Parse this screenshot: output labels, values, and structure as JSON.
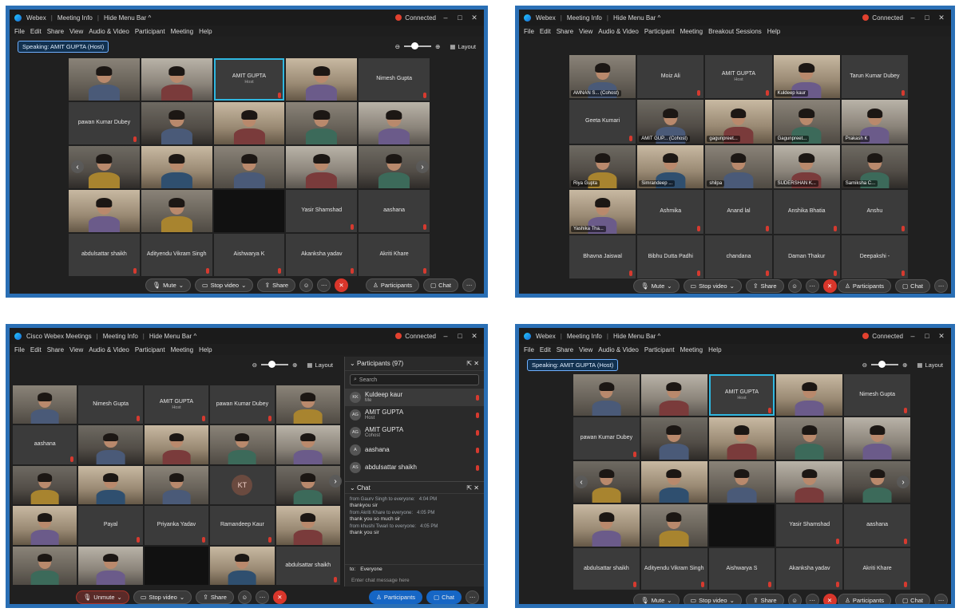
{
  "screens": {
    "tl": {
      "title": {
        "app": "Webex",
        "meeting_info": "Meeting Info",
        "hide_menu": "Hide Menu Bar ^",
        "connected": "Connected"
      },
      "menu": [
        "File",
        "Edit",
        "Share",
        "View",
        "Audio & Video",
        "Participant",
        "Meeting",
        "Help"
      ],
      "speaking": "Speaking: AMIT GUPTA (Host)",
      "layout_label": "Layout",
      "tiles": [
        {
          "type": "video",
          "label": ""
        },
        {
          "type": "video",
          "label": ""
        },
        {
          "type": "name",
          "name": "AMIT GUPTA",
          "sub": "Host",
          "active": true
        },
        {
          "type": "video",
          "label": ""
        },
        {
          "type": "name",
          "name": "Nimesh Gupta"
        },
        {
          "type": "name",
          "name": "pawan Kumar Dubey"
        },
        {
          "type": "video",
          "label": ""
        },
        {
          "type": "video",
          "label": ""
        },
        {
          "type": "video",
          "label": ""
        },
        {
          "type": "video",
          "label": ""
        },
        {
          "type": "video",
          "label": ""
        },
        {
          "type": "video",
          "label": ""
        },
        {
          "type": "video",
          "label": ""
        },
        {
          "type": "video",
          "label": ""
        },
        {
          "type": "video",
          "label": ""
        },
        {
          "type": "video",
          "label": ""
        },
        {
          "type": "video",
          "label": ""
        },
        {
          "type": "black"
        },
        {
          "type": "name",
          "name": "Yasir Shamshad"
        },
        {
          "type": "name",
          "name": "aashana"
        },
        {
          "type": "name",
          "name": "abdulsattar shaikh"
        },
        {
          "type": "name",
          "name": "Adityendu Vikram Singh"
        },
        {
          "type": "name",
          "name": "Aishwarya K"
        },
        {
          "type": "name",
          "name": "Akanksha yadav"
        },
        {
          "type": "name",
          "name": "Akriti Khare"
        }
      ],
      "controls": {
        "mute": "Mute",
        "stop_video": "Stop video",
        "share": "Share",
        "participants": "Participants",
        "chat": "Chat"
      }
    },
    "tr": {
      "title": {
        "app": "Webex",
        "meeting_info": "Meeting Info",
        "hide_menu": "Hide Menu Bar ^",
        "connected": "Connected"
      },
      "menu": [
        "File",
        "Edit",
        "Share",
        "View",
        "Audio & Video",
        "Participant",
        "Meeting",
        "Breakout Sessions",
        "Help"
      ],
      "tiles": [
        {
          "type": "video",
          "label": "AMNAN S... (Cohost)"
        },
        {
          "type": "name",
          "name": "Moiz Ali"
        },
        {
          "type": "name",
          "name": "AMIT GUPTA",
          "sub": "Host"
        },
        {
          "type": "video",
          "label": "Kuldeep kaur"
        },
        {
          "type": "name",
          "name": "Tarun Kumar Dubey"
        },
        {
          "type": "name",
          "name": "Geeta Kumari"
        },
        {
          "type": "video",
          "label": "AMIT GUP... (Cohost)"
        },
        {
          "type": "video",
          "label": "gagunpreet..."
        },
        {
          "type": "video",
          "label": "Gagunpreet..."
        },
        {
          "type": "video",
          "label": "Prakash K"
        },
        {
          "type": "video",
          "label": "Riya Gupta"
        },
        {
          "type": "video",
          "label": "Simrandeep ..."
        },
        {
          "type": "video",
          "label": "shilpa"
        },
        {
          "type": "video",
          "label": "SUDERSHAN K..."
        },
        {
          "type": "video",
          "label": "Samiksha C..."
        },
        {
          "type": "video",
          "label": "Yashika Tha..."
        },
        {
          "type": "name",
          "name": "Ashmika"
        },
        {
          "type": "name",
          "name": "Anand lal"
        },
        {
          "type": "name",
          "name": "Anshika Bhatia"
        },
        {
          "type": "name",
          "name": "Anshu"
        },
        {
          "type": "name",
          "name": "Bhavna Jaiswal"
        },
        {
          "type": "name",
          "name": "Bibhu Dutta Padhi"
        },
        {
          "type": "name",
          "name": "chandana"
        },
        {
          "type": "name",
          "name": "Daman Thakur"
        },
        {
          "type": "name",
          "name": "Deepakshi -"
        }
      ],
      "controls": {
        "mute": "Mute",
        "stop_video": "Stop video",
        "share": "Share",
        "participants": "Participants",
        "chat": "Chat"
      }
    },
    "bl": {
      "title": {
        "app": "Cisco Webex Meetings",
        "meeting_info": "Meeting Info",
        "hide_menu": "Hide Menu Bar ^",
        "connected": "Connected"
      },
      "menu": [
        "File",
        "Edit",
        "Share",
        "View",
        "Audio & Video",
        "Participant",
        "Meeting",
        "Help"
      ],
      "layout_label": "Layout",
      "tiles": [
        {
          "type": "video",
          "label": ""
        },
        {
          "type": "name",
          "name": "Nimesh Gupta"
        },
        {
          "type": "name",
          "name": "AMIT GUPTA",
          "sub": "Host"
        },
        {
          "type": "name",
          "name": "pawan Kumar Dubey"
        },
        {
          "type": "video",
          "label": ""
        },
        {
          "type": "name",
          "name": "aashana"
        },
        {
          "type": "video",
          "label": ""
        },
        {
          "type": "video",
          "label": ""
        },
        {
          "type": "video",
          "label": ""
        },
        {
          "type": "video",
          "label": ""
        },
        {
          "type": "video",
          "label": ""
        },
        {
          "type": "video",
          "label": ""
        },
        {
          "type": "video",
          "label": ""
        },
        {
          "type": "initials",
          "text": "KT"
        },
        {
          "type": "video",
          "label": ""
        },
        {
          "type": "video",
          "label": ""
        },
        {
          "type": "name",
          "name": "Payal"
        },
        {
          "type": "name",
          "name": "Priyanka Yadav"
        },
        {
          "type": "name",
          "name": "Ramandeep Kaur"
        },
        {
          "type": "video",
          "label": ""
        },
        {
          "type": "video",
          "label": ""
        },
        {
          "type": "video",
          "label": ""
        },
        {
          "type": "black"
        },
        {
          "type": "video",
          "label": ""
        },
        {
          "type": "name",
          "name": "abdulsattar shaikh"
        }
      ],
      "panel": {
        "title": "Participants (97)",
        "search_placeholder": "Search",
        "rows": [
          {
            "initials": "KK",
            "name": "Kuldeep kaur",
            "role": "Me"
          },
          {
            "initials": "AG",
            "name": "AMIT GUPTA",
            "role": "Host"
          },
          {
            "initials": "AG",
            "name": "AMIT GUPTA",
            "role": "Cohost"
          },
          {
            "initials": "A",
            "name": "aashana",
            "role": ""
          },
          {
            "initials": "AS",
            "name": "abdulsattar shaikh",
            "role": ""
          }
        ],
        "chat_title": "Chat",
        "chat": [
          {
            "from": "from Gaurv Singh to everyone:",
            "time": "4:04 PM",
            "msg": "thankyou sir"
          },
          {
            "from": "from Akriti Khare to everyone:",
            "time": "4:05 PM",
            "msg": "thank you so much sir"
          },
          {
            "from": "from khushi Tiwari to everyone:",
            "time": "4:05 PM",
            "msg": "thank you sir"
          }
        ],
        "to_label": "to:",
        "to_value": "Everyone",
        "input_placeholder": "Enter chat message here"
      },
      "controls": {
        "mute": "Unmute",
        "stop_video": "Stop video",
        "share": "Share",
        "participants": "Participants",
        "chat": "Chat"
      }
    },
    "br": {
      "title": {
        "app": "Webex",
        "meeting_info": "Meeting Info",
        "hide_menu": "Hide Menu Bar ^",
        "connected": "Connected"
      },
      "menu": [
        "File",
        "Edit",
        "Share",
        "View",
        "Audio & Video",
        "Participant",
        "Meeting",
        "Help"
      ],
      "speaking": "Speaking: AMIT GUPTA (Host)",
      "layout_label": "Layout",
      "tiles": [
        {
          "type": "video",
          "label": ""
        },
        {
          "type": "video",
          "label": ""
        },
        {
          "type": "name",
          "name": "AMIT GUPTA",
          "sub": "Host",
          "active": true
        },
        {
          "type": "video",
          "label": ""
        },
        {
          "type": "name",
          "name": "Nimesh Gupta"
        },
        {
          "type": "name",
          "name": "pawan Kumar Dubey"
        },
        {
          "type": "video",
          "label": ""
        },
        {
          "type": "video",
          "label": ""
        },
        {
          "type": "video",
          "label": ""
        },
        {
          "type": "video",
          "label": ""
        },
        {
          "type": "video",
          "label": ""
        },
        {
          "type": "video",
          "label": ""
        },
        {
          "type": "video",
          "label": ""
        },
        {
          "type": "video",
          "label": ""
        },
        {
          "type": "video",
          "label": ""
        },
        {
          "type": "video",
          "label": ""
        },
        {
          "type": "video",
          "label": ""
        },
        {
          "type": "black"
        },
        {
          "type": "name",
          "name": "Yasir Shamshad"
        },
        {
          "type": "name",
          "name": "aashana"
        },
        {
          "type": "name",
          "name": "abdulsattar shaikh"
        },
        {
          "type": "name",
          "name": "Adityendu Vikram Singh"
        },
        {
          "type": "name",
          "name": "Aishwarya S"
        },
        {
          "type": "name",
          "name": "Akanksha yadav"
        },
        {
          "type": "name",
          "name": "Akriti Khare"
        }
      ],
      "controls": {
        "mute": "Mute",
        "stop_video": "Stop video",
        "share": "Share",
        "participants": "Participants",
        "chat": "Chat"
      }
    }
  }
}
